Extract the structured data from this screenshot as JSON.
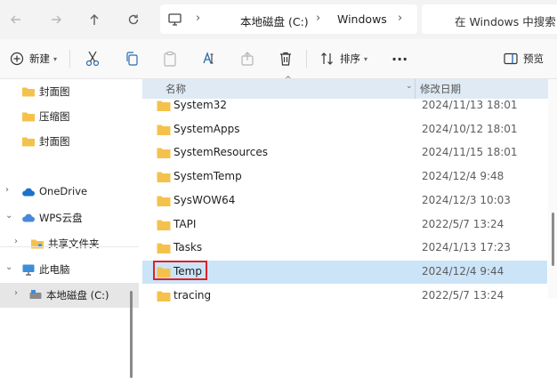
{
  "address": {
    "path": [
      "本地磁盘 (C:)",
      "Windows"
    ],
    "search_placeholder": "在 Windows 中搜索"
  },
  "toolbar": {
    "new_label": "新建",
    "sort_label": "排序",
    "preview_label": "预览",
    "more_label": "···"
  },
  "nav": {
    "items": [
      {
        "label": "封面图"
      },
      {
        "label": "压缩图"
      },
      {
        "label": "封面图"
      },
      {
        "label": "OneDrive"
      },
      {
        "label": "WPS云盘"
      },
      {
        "label": "共享文件夹"
      },
      {
        "label": "此电脑"
      },
      {
        "label": "本地磁盘 (C:)"
      }
    ]
  },
  "columns": {
    "name": "名称",
    "modified": "修改日期"
  },
  "files": [
    {
      "name": "System32",
      "date": "2024/11/13 18:01"
    },
    {
      "name": "SystemApps",
      "date": "2024/10/12 18:01"
    },
    {
      "name": "SystemResources",
      "date": "2024/11/15 18:01"
    },
    {
      "name": "SystemTemp",
      "date": "2024/12/4 9:48"
    },
    {
      "name": "SysWOW64",
      "date": "2024/12/3 10:03"
    },
    {
      "name": "TAPI",
      "date": "2022/5/7 13:24"
    },
    {
      "name": "Tasks",
      "date": "2024/1/13 17:23"
    },
    {
      "name": "Temp",
      "date": "2024/12/4 9:44",
      "selected": true
    },
    {
      "name": "tracing",
      "date": "2022/5/7 13:24"
    }
  ],
  "colors": {
    "folder": "#f4c24c",
    "selection": "#cce4f7",
    "highlight_box": "#e0202a",
    "onedrive": "#1a73c8"
  }
}
